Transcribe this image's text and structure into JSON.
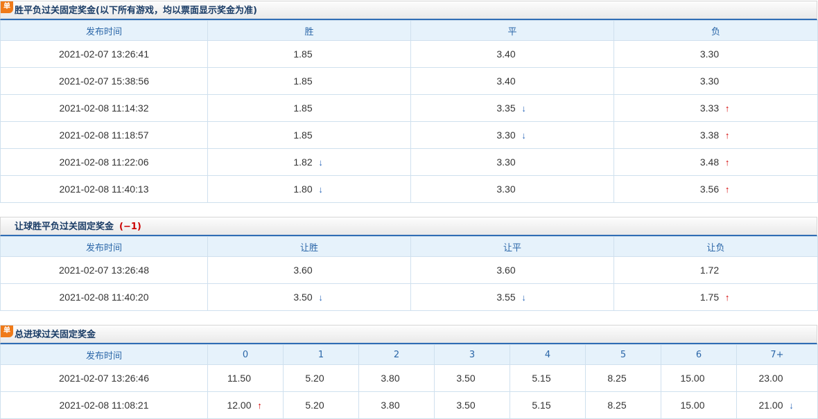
{
  "colors": {
    "up": "#d40000",
    "down": "#2b67b8",
    "badge": "#f07a18",
    "header_text": "#2a66a8"
  },
  "section1": {
    "badge": "单",
    "title": "胜平负过关固定奖金(以下所有游戏，均以票面显示奖金为准)",
    "headers": [
      "发布时间",
      "胜",
      "平",
      "负"
    ],
    "rows": [
      [
        {
          "v": "2021-02-07 13:26:41"
        },
        {
          "v": "1.85"
        },
        {
          "v": "3.40"
        },
        {
          "v": "3.30"
        }
      ],
      [
        {
          "v": "2021-02-07 15:38:56"
        },
        {
          "v": "1.85"
        },
        {
          "v": "3.40"
        },
        {
          "v": "3.30"
        }
      ],
      [
        {
          "v": "2021-02-08 11:14:32"
        },
        {
          "v": "1.85"
        },
        {
          "v": "3.35",
          "t": "down"
        },
        {
          "v": "3.33",
          "t": "up"
        }
      ],
      [
        {
          "v": "2021-02-08 11:18:57"
        },
        {
          "v": "1.85"
        },
        {
          "v": "3.30",
          "t": "down"
        },
        {
          "v": "3.38",
          "t": "up"
        }
      ],
      [
        {
          "v": "2021-02-08 11:22:06"
        },
        {
          "v": "1.82",
          "t": "down"
        },
        {
          "v": "3.30"
        },
        {
          "v": "3.48",
          "t": "up"
        }
      ],
      [
        {
          "v": "2021-02-08 11:40:13"
        },
        {
          "v": "1.80",
          "t": "down"
        },
        {
          "v": "3.30"
        },
        {
          "v": "3.56",
          "t": "up"
        }
      ]
    ]
  },
  "section2": {
    "title": "让球胜平负过关固定奖金",
    "handicap": "(−1)",
    "headers": [
      "发布时间",
      "让胜",
      "让平",
      "让负"
    ],
    "rows": [
      [
        {
          "v": "2021-02-07 13:26:48"
        },
        {
          "v": "3.60"
        },
        {
          "v": "3.60"
        },
        {
          "v": "1.72"
        }
      ],
      [
        {
          "v": "2021-02-08 11:40:20"
        },
        {
          "v": "3.50",
          "t": "down"
        },
        {
          "v": "3.55",
          "t": "down"
        },
        {
          "v": "1.75",
          "t": "up"
        }
      ]
    ]
  },
  "section3": {
    "badge": "单",
    "title": "总进球过关固定奖金",
    "headers": [
      "发布时间",
      "0",
      "1",
      "2",
      "3",
      "4",
      "5",
      "6",
      "7+"
    ],
    "rows": [
      [
        {
          "v": "2021-02-07 13:26:46"
        },
        {
          "v": "11.50"
        },
        {
          "v": "5.20"
        },
        {
          "v": "3.80"
        },
        {
          "v": "3.50"
        },
        {
          "v": "5.15"
        },
        {
          "v": "8.25"
        },
        {
          "v": "15.00"
        },
        {
          "v": "23.00"
        }
      ],
      [
        {
          "v": "2021-02-08 11:08:21"
        },
        {
          "v": "12.00",
          "t": "up"
        },
        {
          "v": "5.20"
        },
        {
          "v": "3.80"
        },
        {
          "v": "3.50"
        },
        {
          "v": "5.15"
        },
        {
          "v": "8.25"
        },
        {
          "v": "15.00"
        },
        {
          "v": "21.00",
          "t": "down"
        }
      ]
    ]
  }
}
